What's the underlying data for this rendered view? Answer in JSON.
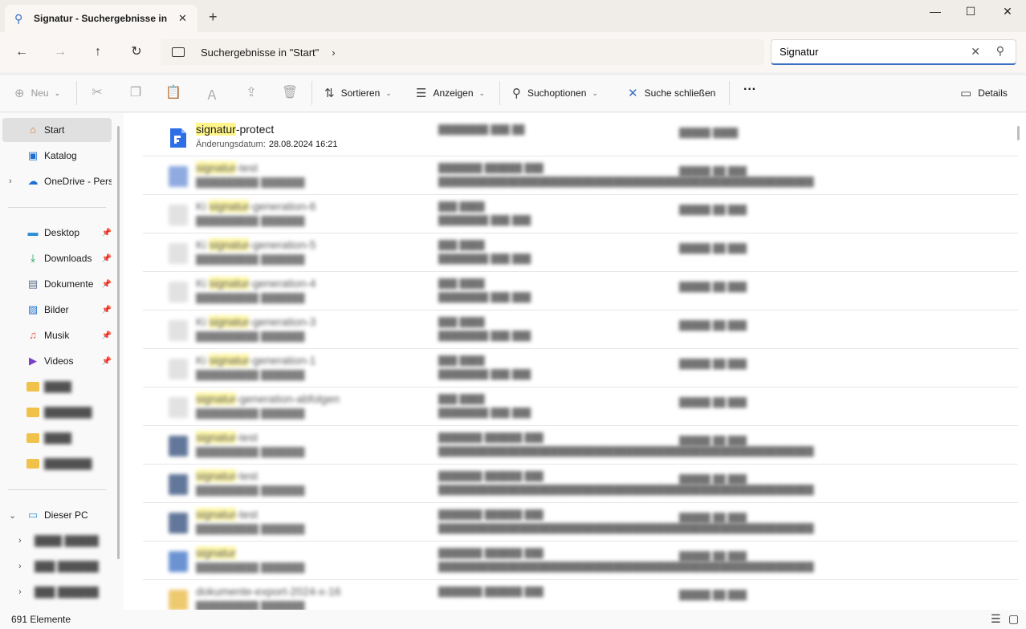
{
  "tab": {
    "title": "Signatur - Suchergebnisse in \"",
    "close": "✕",
    "new": "+"
  },
  "window": {
    "minimize": "—",
    "maximize": "☐",
    "close": "✕"
  },
  "nav": {
    "back": "←",
    "forward": "→",
    "up": "↑",
    "refresh": "↻"
  },
  "address": {
    "crumb": "Suchergebnisse in \"Start\"",
    "sep": "›"
  },
  "search": {
    "value": "Signatur",
    "clear": "✕"
  },
  "commands": {
    "neu": "Neu",
    "sortieren": "Sortieren",
    "anzeigen": "Anzeigen",
    "suchoptionen": "Suchoptionen",
    "suche_schliessen": "Suche schließen",
    "more": "···",
    "details": "Details",
    "caret": "⌄"
  },
  "sidebar": {
    "start": "Start",
    "katalog": "Katalog",
    "onedrive": "OneDrive - Pers",
    "desktop": "Desktop",
    "downloads": "Downloads",
    "dokumente": "Dokumente",
    "bilder": "Bilder",
    "musik": "Musik",
    "videos": "Videos",
    "dieser_pc": "Dieser PC"
  },
  "first_result": {
    "name_highlight": "signatur",
    "name_rest": "-protect",
    "meta_label": "Änderungsdatum:",
    "meta_value": "28.08.2024 16:21"
  },
  "blurred_rows": [
    {
      "hl": "signatur",
      "rest": "-test"
    },
    {
      "hl": "signatur",
      "pre": "Ki ",
      "rest": "-generation-6"
    },
    {
      "hl": "signatur",
      "pre": "Ki ",
      "rest": "-generation-5"
    },
    {
      "hl": "signatur",
      "pre": "Ki ",
      "rest": "-generation-4"
    },
    {
      "hl": "signatur",
      "pre": "Ki ",
      "rest": "-generation-3"
    },
    {
      "hl": "signatur",
      "pre": "Ki ",
      "rest": "-generation-1"
    },
    {
      "hl": "signatur",
      "rest": "-generation-abfolgen"
    },
    {
      "hl": "signatur",
      "rest": "-test"
    },
    {
      "hl": "signatur",
      "rest": "-test"
    },
    {
      "hl": "signatur",
      "rest": "-test"
    },
    {
      "hl": "signatur",
      "rest": ""
    },
    {
      "hl": "",
      "rest": "dokumente-export-2024-x-16"
    }
  ],
  "status": {
    "count": "691 Elemente"
  }
}
